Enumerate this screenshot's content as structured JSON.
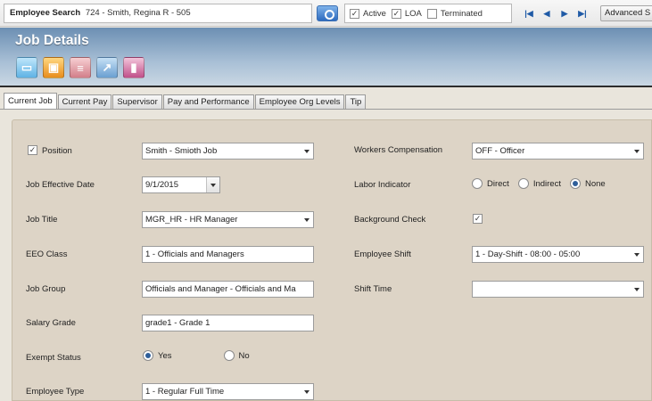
{
  "search": {
    "label": "Employee Search",
    "value": "724 - Smith, Regina R - 505",
    "filters": [
      {
        "label": "Active",
        "checked": true
      },
      {
        "label": "LOA",
        "checked": true
      },
      {
        "label": "Terminated",
        "checked": false
      }
    ],
    "advanced_label": "Advanced S"
  },
  "icons": {
    "search": "search-icon",
    "first": "first-record-icon",
    "prev": "previous-record-icon",
    "next": "next-record-icon",
    "last": "last-record-icon",
    "check": "✓"
  },
  "header": {
    "title": "Job Details",
    "toolbar": [
      "new-document-icon",
      "save-icon",
      "print-icon",
      "export-icon",
      "exit-icon"
    ]
  },
  "tabs": [
    "Current Job",
    "Current Pay",
    "Supervisor",
    "Pay and Performance",
    "Employee Org Levels",
    "Tip"
  ],
  "form": {
    "position_label": "Position",
    "position_checked": true,
    "position_value": "Smith - Smioth Job",
    "job_effective_date_label": "Job Effective Date",
    "job_effective_date_value": "9/1/2015",
    "job_title_label": "Job Title",
    "job_title_value": "MGR_HR - HR Manager",
    "eeo_class_label": "EEO Class",
    "eeo_class_value": "1 - Officials and Managers",
    "job_group_label": "Job Group",
    "job_group_value": "Officials and Manager - Officials and Ma",
    "salary_grade_label": "Salary Grade",
    "salary_grade_value": "grade1 - Grade 1",
    "exempt_status_label": "Exempt Status",
    "exempt_options": [
      "Yes",
      "No"
    ],
    "exempt_selected": "Yes",
    "employee_type_label": "Employee Type",
    "employee_type_value": "1 - Regular Full Time",
    "workers_comp_label": "Workers Compensation",
    "workers_comp_value": "OFF - Officer",
    "labor_indicator_label": "Labor Indicator",
    "labor_options": [
      "Direct",
      "Indirect",
      "None"
    ],
    "labor_selected": "None",
    "background_check_label": "Background Check",
    "background_check_checked": true,
    "employee_shift_label": "Employee Shift",
    "employee_shift_value": "1 - Day-Shift - 08:00 - 05:00",
    "shift_time_label": "Shift Time",
    "shift_time_value": ""
  },
  "colors": {
    "header_blue": "#6c8fb3",
    "panel_tan": "#ddd4c6",
    "radio_selected": "#2f5f9a"
  }
}
